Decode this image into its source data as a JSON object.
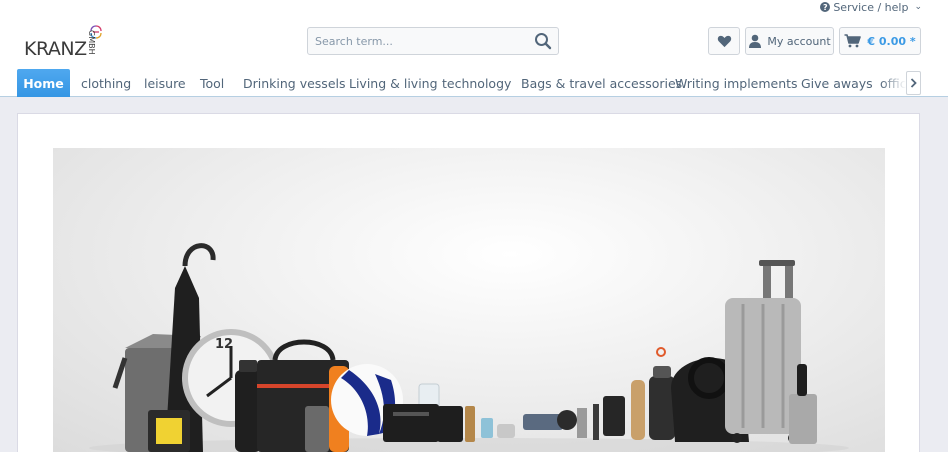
{
  "top_bar": {
    "service_label": "Service / help"
  },
  "logo": {
    "word": "KRANZ",
    "suffix": "GMBH"
  },
  "search": {
    "placeholder": "Search term..."
  },
  "header_buttons": {
    "account_label": "My account",
    "cart_total": "€ 0.00 *"
  },
  "nav": {
    "items": [
      {
        "label": "Home",
        "active": true
      },
      {
        "label": "clothing"
      },
      {
        "label": "leisure"
      },
      {
        "label": "Tool"
      },
      {
        "label": "Drinking vessels"
      },
      {
        "label": "Living & living"
      },
      {
        "label": "technology"
      },
      {
        "label": "Bags & travel accessories"
      },
      {
        "label": "Writing implements"
      },
      {
        "label": "Give aways"
      },
      {
        "label": "office"
      }
    ]
  },
  "colors": {
    "accent": "#3596e4",
    "text": "#52667a",
    "page_bg": "#ebecf2"
  },
  "icons": {
    "service": "question-circle-icon",
    "wishlist": "heart-icon",
    "account": "user-icon",
    "cart": "cart-icon",
    "search": "search-icon",
    "next": "chevron-right-icon"
  }
}
